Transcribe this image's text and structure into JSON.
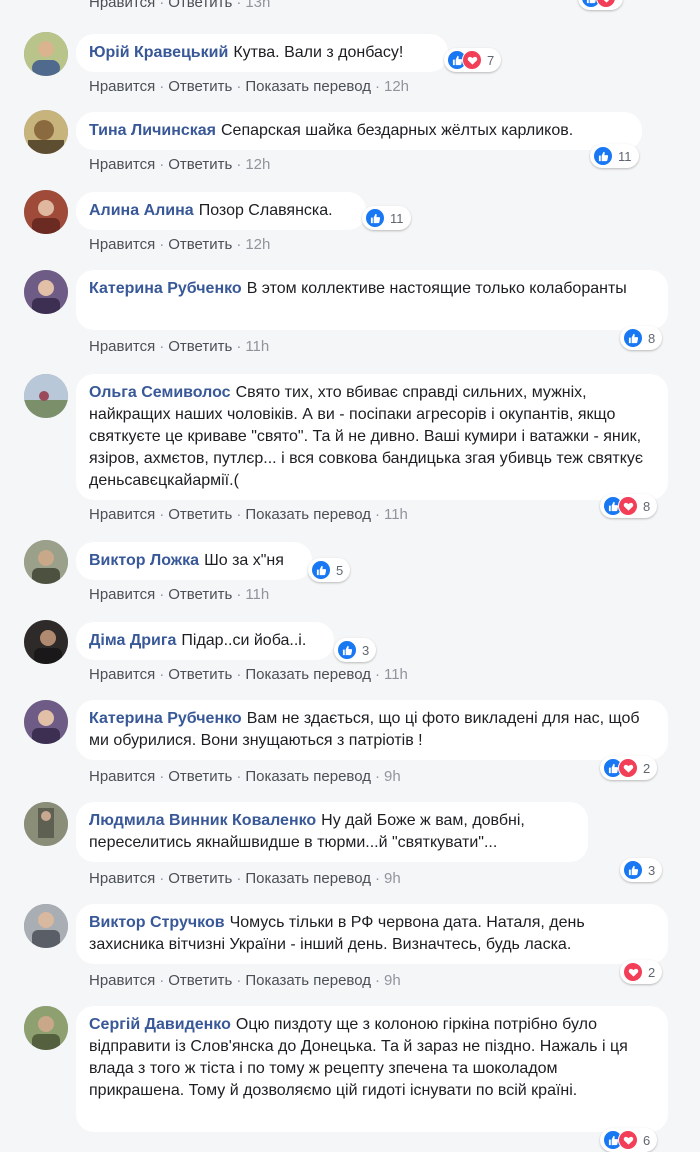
{
  "top_partial": {
    "like": "Нравится",
    "reply": "Ответить",
    "time": "13h"
  },
  "labels": {
    "like": "Нравится",
    "reply": "Ответить",
    "translate": "Показать перевод",
    "sep": "·"
  },
  "colors": {
    "author": "#385898",
    "like_icon": "#1877f2",
    "love_icon": "#f33e58",
    "bubble": "#ffffff",
    "page_bg": "#f5f6f7"
  },
  "comments": [
    {
      "author": "Юрій Кравецький",
      "text": "Кутва. Вали з донбасу!",
      "reactions": [
        "like-icon",
        "love-icon"
      ],
      "count": "7",
      "translate": true,
      "time": "12h",
      "avatar_color": "#9aa86e"
    },
    {
      "author": "Тина Личинская",
      "text": "Сепарская шайка бездарных жёлтых карликов.",
      "reactions": [
        "like-icon"
      ],
      "count": "11",
      "translate": false,
      "time": "12h",
      "avatar_color": "#7b6a4e"
    },
    {
      "author": "Алина Алина",
      "text": "Позор Славянска.",
      "reactions": [
        "like-icon"
      ],
      "count": "11",
      "translate": false,
      "time": "12h",
      "avatar_color": "#8a4d3a"
    },
    {
      "author": "Катерина Рубченко",
      "text": "В этом коллективе настоящие только колаборанты",
      "reactions": [
        "like-icon"
      ],
      "count": "8",
      "translate": false,
      "time": "11h",
      "avatar_color": "#5a4a6e"
    },
    {
      "author": "Ольга Семиволос",
      "text": "Свято тих, хто вбиває справді сильних, мужніх, найкращих наших чоловіків. А ви - посіпаки агресорів і окупантів, якщо святкуєте це криваве \"свято\". Та й не дивно. Ваші кумири і ватажки - яник, язіров, ахмєтов, путлєр... і вся совкова бандицька згая убивць теж святкує деньсавєцкайармії.(",
      "reactions": [
        "like-icon",
        "love-icon"
      ],
      "count": "8",
      "translate": true,
      "time": "11h",
      "avatar_color": "#7d8fa3"
    },
    {
      "author": "Виктор Ложка",
      "text": "Шо за х\"ня",
      "reactions": [
        "like-icon"
      ],
      "count": "5",
      "translate": false,
      "time": "11h",
      "avatar_color": "#6f735f"
    },
    {
      "author": "Діма Дрига",
      "text": "Підар..си йоба..і.",
      "reactions": [
        "like-icon"
      ],
      "count": "3",
      "translate": true,
      "time": "11h",
      "avatar_color": "#3e3a3a"
    },
    {
      "author": "Катерина Рубченко",
      "text": "Вам не здається, що ці фото викладені для нас, щоб ми обурилися. Вони знущаються з патріотів !",
      "reactions": [
        "like-icon",
        "love-icon"
      ],
      "count": "2",
      "translate": true,
      "time": "9h",
      "avatar_color": "#5a4a6e"
    },
    {
      "author": "Людмила Винник Коваленко",
      "text": "Ну дай Боже ж вам, довбні, переселитись якнайшвидше в тюрми...й \"святкувати\"...",
      "reactions": [
        "like-icon"
      ],
      "count": "3",
      "translate": true,
      "time": "9h",
      "avatar_color": "#6a6e5a"
    },
    {
      "author": "Виктор Стручков",
      "text": "Чомусь тільки в РФ червона дата. Наталя, день захисника вітчизні України - інший день. Визначтесь, будь ласка.",
      "reactions": [
        "love-icon"
      ],
      "count": "2",
      "translate": true,
      "time": "9h",
      "avatar_color": "#8b8f96"
    },
    {
      "author": "Сергій Давиденко",
      "text": "Оцю пиздоту ще з колоною гіркіна потрібно було відправити із Слов'янска до Донецька. Та й зараз не піздно. Нажаль і ця влада з того ж тіста і по тому ж рецепту зпечена та шоколадом прикрашена. Тому й дозволяємо цій гидоті існувати по всій країні.",
      "reactions": [
        "like-icon",
        "love-icon"
      ],
      "count": "6",
      "translate": false,
      "time": "",
      "avatar_color": "#7a8a5e"
    }
  ]
}
